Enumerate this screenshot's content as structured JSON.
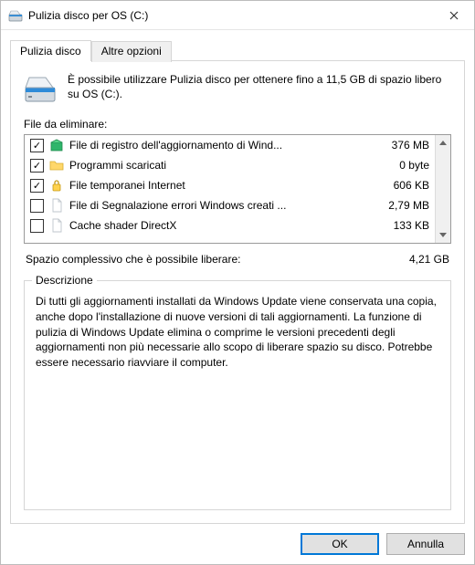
{
  "window": {
    "title": "Pulizia disco per OS (C:)"
  },
  "tabs": {
    "active": "Pulizia disco",
    "inactive": "Altre opzioni"
  },
  "intro": "È possibile utilizzare Pulizia disco per ottenere fino a 11,5 GB di spazio libero su OS (C:).",
  "files_label": "File da eliminare:",
  "items": [
    {
      "checked": true,
      "icon": "package-icon",
      "name": "File di registro dell'aggiornamento di Wind...",
      "size": "376 MB"
    },
    {
      "checked": true,
      "icon": "folder-icon",
      "name": "Programmi scaricati",
      "size": "0 byte"
    },
    {
      "checked": true,
      "icon": "lock-icon",
      "name": "File temporanei Internet",
      "size": "606 KB"
    },
    {
      "checked": false,
      "icon": "file-icon",
      "name": "File di Segnalazione errori Windows creati ...",
      "size": "2,79 MB"
    },
    {
      "checked": false,
      "icon": "file-icon",
      "name": "Cache shader DirectX",
      "size": "133 KB"
    }
  ],
  "total": {
    "label": "Spazio complessivo che è possibile liberare:",
    "value": "4,21 GB"
  },
  "description": {
    "title": "Descrizione",
    "text": "Di tutti gli aggiornamenti installati da Windows Update viene conservata una copia, anche dopo l'installazione di nuove versioni di tali aggiornamenti. La funzione di pulizia di Windows Update elimina o comprime le versioni precedenti degli aggiornamenti non più necessarie allo scopo di liberare spazio su disco. Potrebbe essere necessario riavviare il computer."
  },
  "buttons": {
    "ok": "OK",
    "cancel": "Annulla"
  }
}
